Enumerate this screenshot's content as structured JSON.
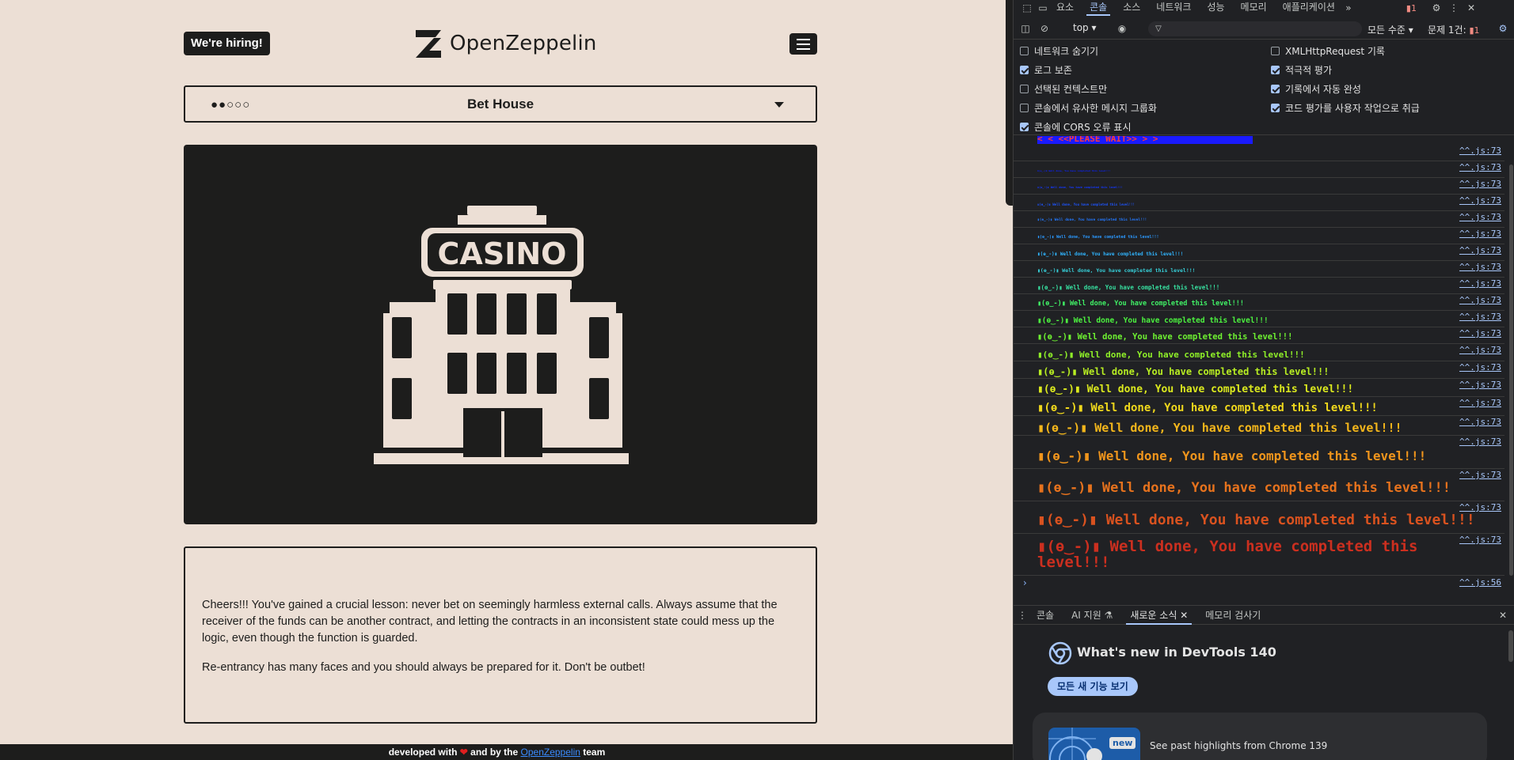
{
  "page": {
    "hiring_label": "We're hiring!",
    "brand": "OpenZeppelin",
    "level": {
      "dots": "●●○○○",
      "title": "Bet House"
    },
    "hero": {
      "sign_text": "CASINO",
      "icon": "casino-building-icon"
    },
    "description": {
      "p1": "Cheers!!! You've gained a crucial lesson: never bet on seemingly harmless external calls. Always assume that the receiver of the funds can be another contract, and letting the contracts in an inconsistent state could mess up the logic, even though the function is guarded.",
      "p2": "Re-entrancy has many faces and you should always be prepared for it. Don't be outbet!"
    },
    "footer": {
      "before": "developed with",
      "and": "and  by the",
      "link": "OpenZeppelin",
      "after": "team"
    }
  },
  "devtools": {
    "tabs": [
      {
        "label": "요소"
      },
      {
        "label": "콘솔"
      },
      {
        "label": "소스"
      },
      {
        "label": "네트워크"
      },
      {
        "label": "성능"
      },
      {
        "label": "메모리"
      },
      {
        "label": "애플리케이션"
      }
    ],
    "error_count": "1",
    "context": "top",
    "levels": "모든 수준",
    "issues_label": "문제 1건:",
    "issues_count": "1",
    "settings": [
      {
        "label": "네트워크 숨기기",
        "checked": false
      },
      {
        "label": "로그 보존",
        "checked": true
      },
      {
        "label": "선택된 컨텍스트만",
        "checked": false
      },
      {
        "label": "콘솔에서 유사한 메시지 그룹화",
        "checked": false
      },
      {
        "label": "콘솔에 CORS 오류 표시",
        "checked": true
      },
      {
        "label": "XMLHttpRequest 기록",
        "checked": false
      },
      {
        "label": "적극적 평가",
        "checked": true
      },
      {
        "label": "기록에서 자동 완성",
        "checked": true
      },
      {
        "label": "코드 평가를 사용자 작업으로 취급",
        "checked": true
      }
    ],
    "console": {
      "banner": "< < <<PLEASE WAIT>> > >",
      "message": "▮(ɵ‿-)▮ Well done, You have completed this level!!!",
      "rows": [
        {
          "src": "^^.js:73"
        },
        {
          "src": "^^.js:73"
        },
        {
          "src": "^^.js:73"
        },
        {
          "src": "^^.js:73"
        },
        {
          "src": "^^.js:73"
        },
        {
          "src": "^^.js:73"
        },
        {
          "src": "^^.js:73"
        },
        {
          "src": "^^.js:73"
        },
        {
          "src": "^^.js:73"
        },
        {
          "src": "^^.js:73"
        },
        {
          "src": "^^.js:73"
        },
        {
          "src": "^^.js:73"
        },
        {
          "src": "^^.js:73"
        },
        {
          "src": "^^.js:73"
        },
        {
          "src": "^^.js:73"
        },
        {
          "src": "^^.js:73"
        },
        {
          "src": "^^.js:73"
        },
        {
          "src": "^^.js:73"
        },
        {
          "src": "^^.js:73"
        },
        {
          "src": "^^.js:73"
        },
        {
          "src": "^^.js:73"
        }
      ],
      "last_line_1": "▮(ɵ‿-)▮ Well done, You have completed this",
      "last_line_2": "level!!!",
      "last_src": "^^.js:56",
      "colors": [
        "#0b22ff",
        "#1438ff",
        "#1e55ff",
        "#2479ff",
        "#2b99ff",
        "#30b5ff",
        "#36cfd8",
        "#37e0a0",
        "#40ef65",
        "#4cf23f",
        "#6ef231",
        "#8ff028",
        "#b8ee22",
        "#dbe91e",
        "#f0d81c",
        "#f3b61b",
        "#f0951c",
        "#e6721d",
        "#d9521f",
        "#cc2f1f"
      ]
    },
    "drawer_tabs": [
      {
        "label": "콘솔"
      },
      {
        "label": "AI 지원"
      },
      {
        "label": "새로운 소식"
      },
      {
        "label": "메모리 검사기"
      }
    ],
    "whats_new": {
      "title": "What's new in DevTools 140",
      "button": "모든 새 기능 보기",
      "new_badge": "new",
      "card_text": "See past highlights from Chrome 139"
    }
  }
}
